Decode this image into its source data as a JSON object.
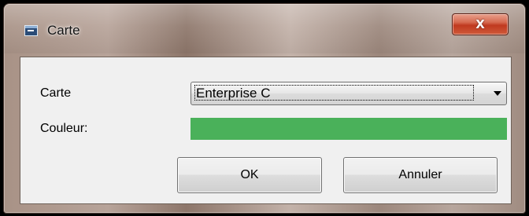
{
  "window": {
    "title": "Carte",
    "close_label": "X"
  },
  "form": {
    "carte_label": "Carte",
    "carte_value": "Enterprise C",
    "couleur_label": "Couleur:",
    "couleur_color": "#4ab15a"
  },
  "buttons": {
    "ok_label": "OK",
    "cancel_label": "Annuler"
  },
  "icons": {
    "app": "card-icon",
    "dropdown": "chevron-down-icon",
    "close": "close-icon"
  }
}
